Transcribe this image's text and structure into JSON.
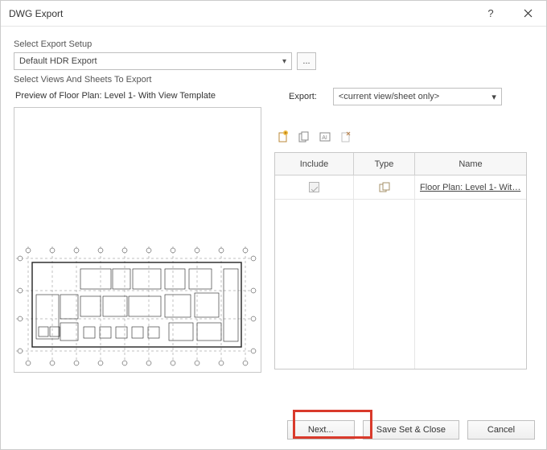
{
  "titlebar": {
    "title": "DWG Export"
  },
  "setup": {
    "group_label": "Select Export Setup",
    "selected": "Default HDR Export",
    "ellipsis": "..."
  },
  "views": {
    "group_label": "Select Views And Sheets To Export",
    "preview_label": "Preview of Floor Plan: Level 1- With View Template",
    "export_label": "Export:",
    "export_selected": "<current view/sheet only>"
  },
  "grid": {
    "headers": {
      "include": "Include",
      "type": "Type",
      "name": "Name"
    },
    "rows": [
      {
        "include_checked": true,
        "name": "Floor Plan: Level 1- Wit…"
      }
    ]
  },
  "buttons": {
    "next": "Next...",
    "save_close": "Save Set & Close",
    "cancel": "Cancel"
  }
}
